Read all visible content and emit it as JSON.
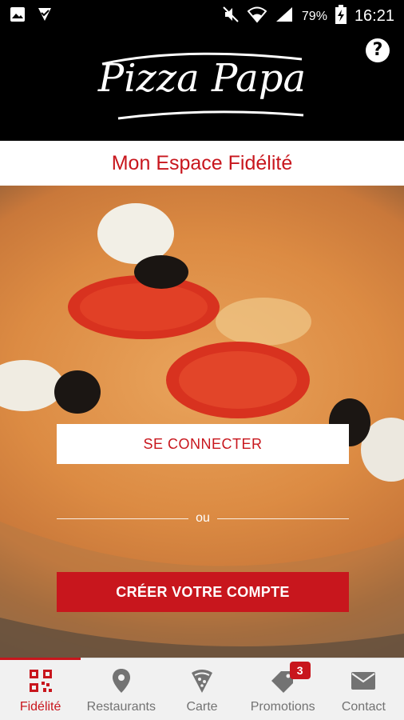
{
  "status_bar": {
    "battery_percent": "79%",
    "time": "16:21",
    "left_icons": [
      "image-icon",
      "download-check-icon"
    ],
    "right_icons": [
      "mute-icon",
      "wifi-icon",
      "signal-icon",
      "battery-charging-icon"
    ]
  },
  "header": {
    "logo_text": "Pizza Papa",
    "help_label": "?"
  },
  "page": {
    "title": "Mon Espace Fidélité"
  },
  "actions": {
    "connect_label": "SE CONNECTER",
    "or_label": "ou",
    "create_label": "CRÉER VOTRE COMPTE"
  },
  "nav": {
    "items": [
      {
        "label": "Fidélité",
        "icon": "qr-code-icon",
        "active": true
      },
      {
        "label": "Restaurants",
        "icon": "map-pin-icon"
      },
      {
        "label": "Carte",
        "icon": "pizza-slice-icon"
      },
      {
        "label": "Promotions",
        "icon": "tag-icon",
        "badge": "3"
      },
      {
        "label": "Contact",
        "icon": "envelope-icon"
      }
    ]
  },
  "colors": {
    "brand_red": "#c8161d",
    "header_bg": "#000000",
    "nav_bg": "#f1f1f1",
    "nav_inactive": "#737373"
  }
}
